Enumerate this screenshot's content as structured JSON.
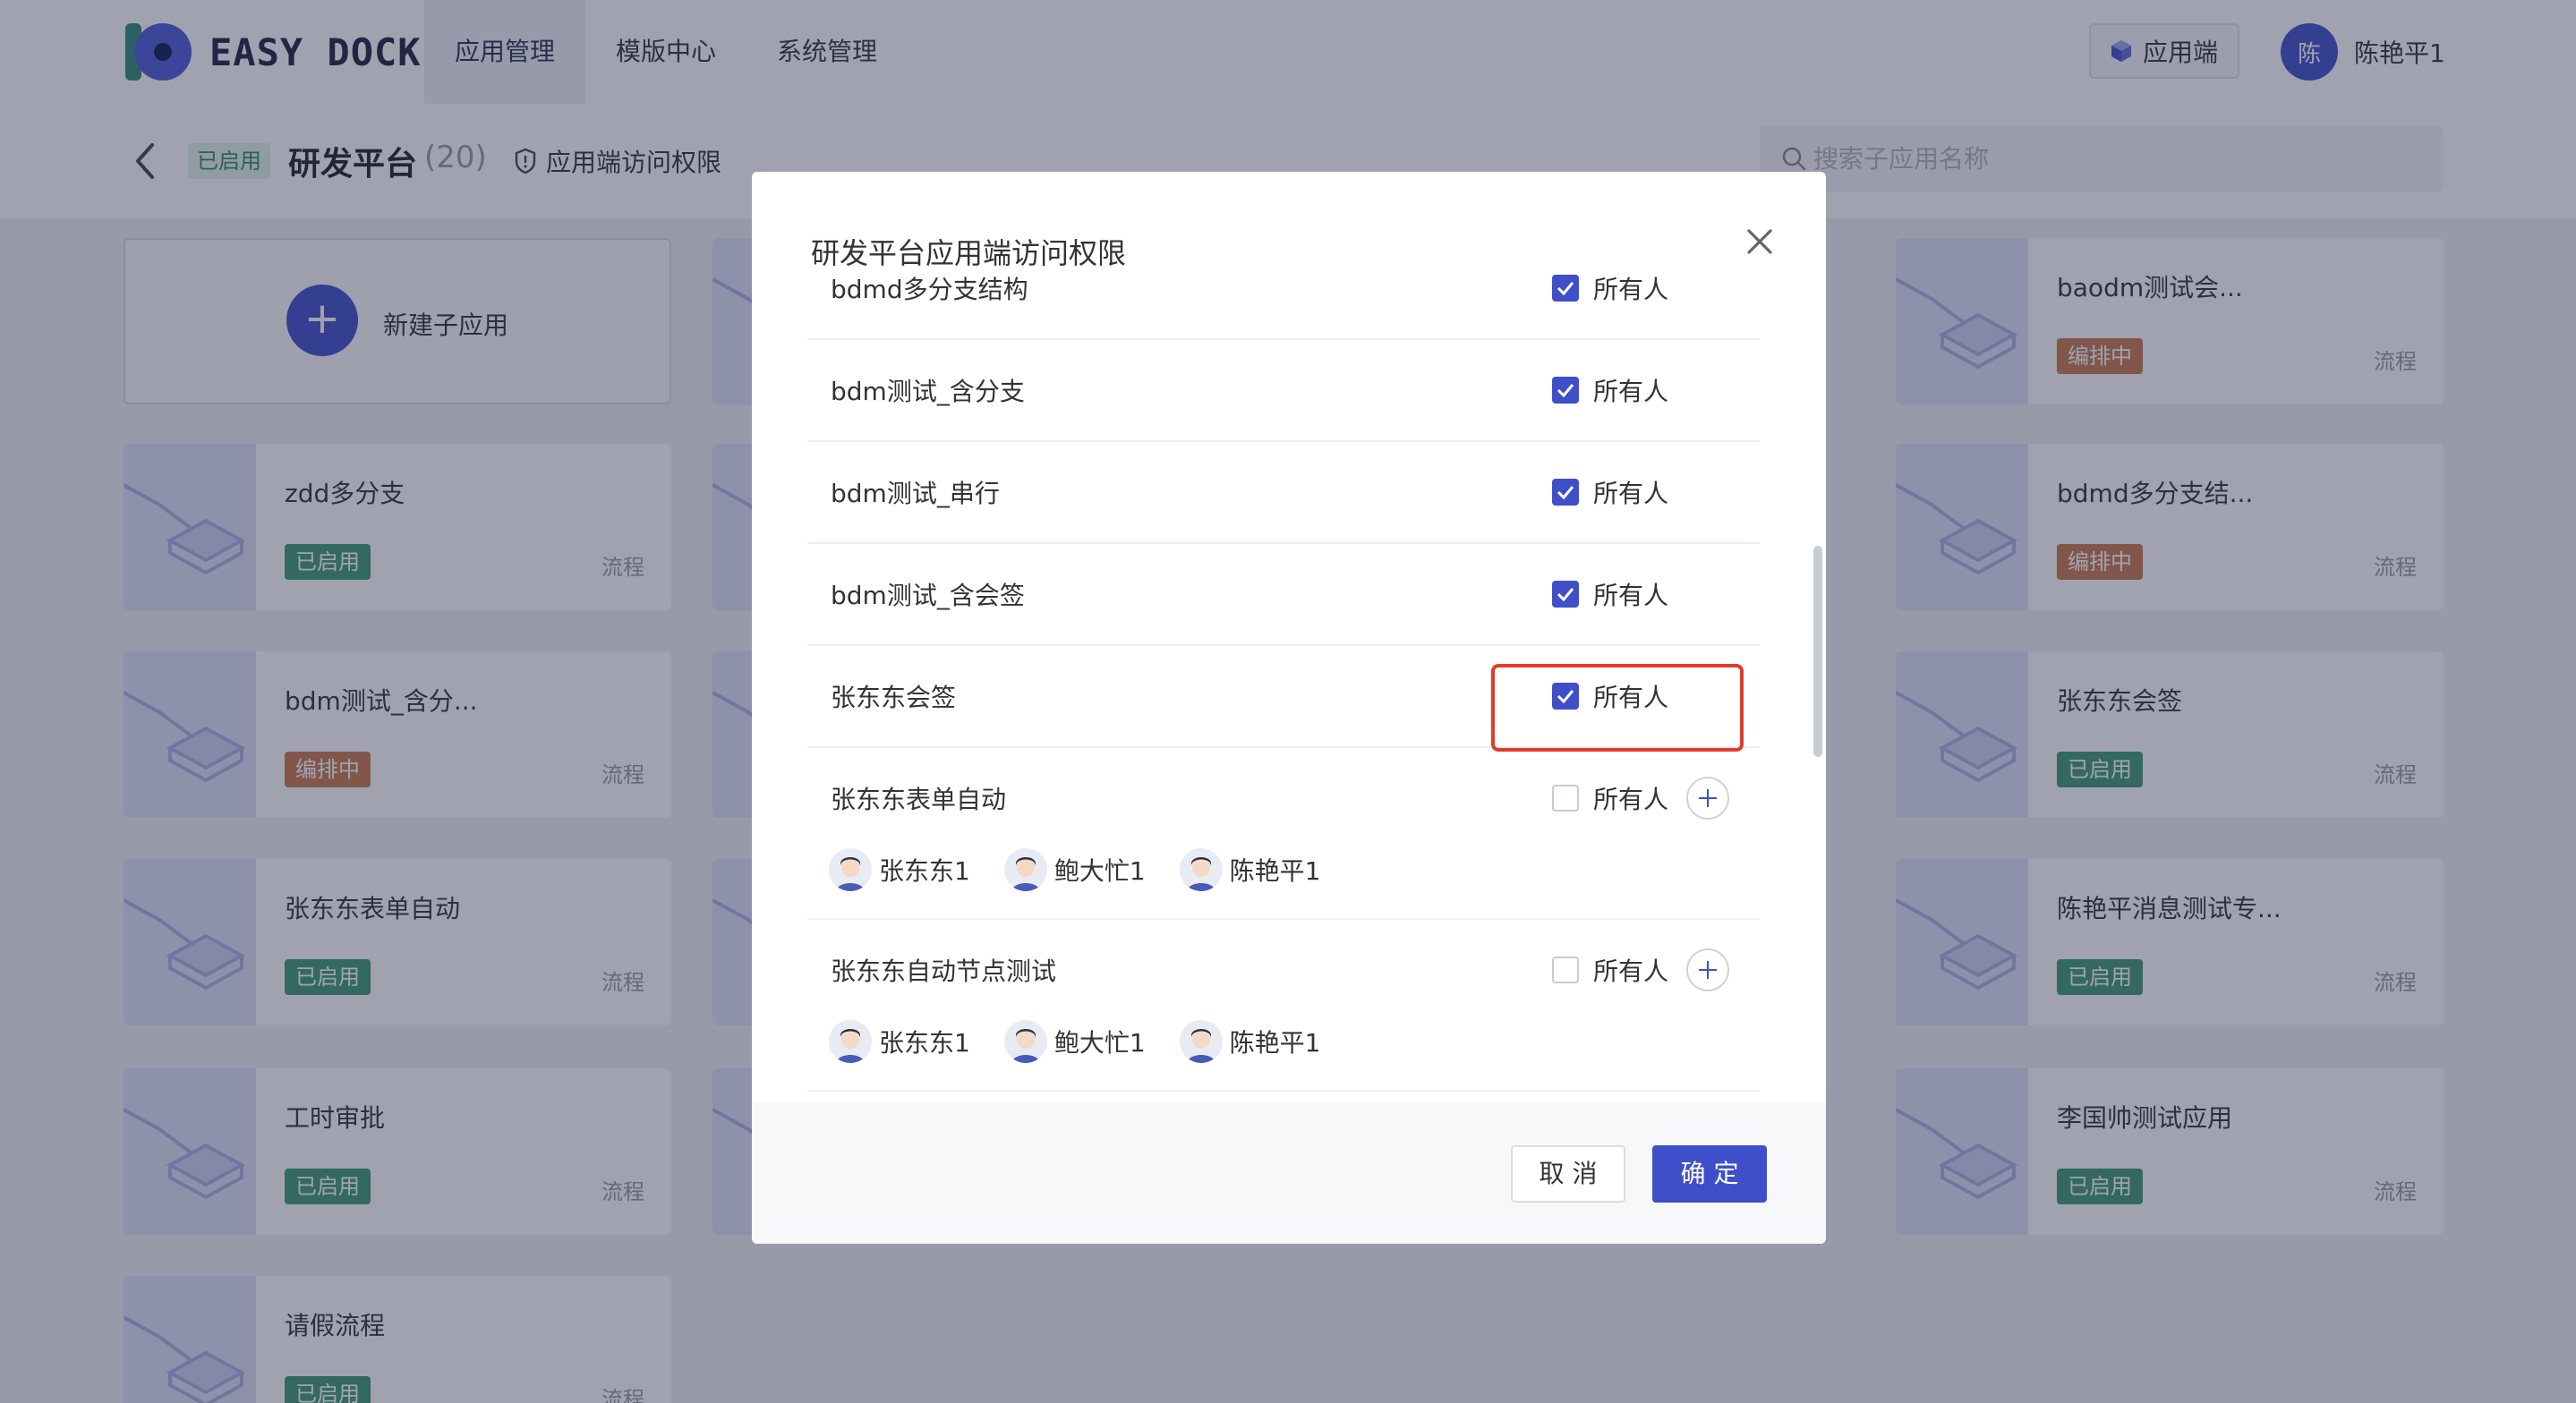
{
  "brand": {
    "name": "EASY DOCK"
  },
  "nav": {
    "items": [
      "应用管理",
      "模版中心",
      "系统管理"
    ]
  },
  "header": {
    "app_end_label": "应用端",
    "user_initial": "陈",
    "user_name": "陈艳平1"
  },
  "subheader": {
    "status": "已启用",
    "title": "研发平台",
    "count": "(20)",
    "perm_link": "应用端访问权限",
    "search_placeholder": "搜索子应用名称"
  },
  "cards": {
    "new_label": "新建子应用",
    "left": [
      {
        "name": "zdd多分支",
        "status": "已启用",
        "type": "流程"
      },
      {
        "name": "bdm测试_含分...",
        "status": "编排中",
        "type": "流程"
      },
      {
        "name": "张东东表单自动",
        "status": "已启用",
        "type": "流程"
      },
      {
        "name": "工时审批",
        "status": "已启用",
        "type": "流程"
      },
      {
        "name": "请假流程",
        "status": "已启用",
        "type": "流程"
      }
    ],
    "right": [
      {
        "name": "baodm测试会...",
        "status": "编排中",
        "type": "流程"
      },
      {
        "name": "bdmd多分支结...",
        "status": "编排中",
        "type": "流程"
      },
      {
        "name": "张东东会签",
        "status": "已启用",
        "type": "流程"
      },
      {
        "name": "陈艳平消息测试专...",
        "status": "已启用",
        "type": "流程"
      },
      {
        "name": "李国帅测试应用",
        "status": "已启用",
        "type": "流程"
      }
    ]
  },
  "modal": {
    "title": "研发平台应用端访问权限",
    "everyone_label": "所有人",
    "rows": [
      {
        "name": "bdmd多分支结构",
        "checked": true
      },
      {
        "name": "bdm测试_含分支",
        "checked": true
      },
      {
        "name": "bdm测试_串行",
        "checked": true
      },
      {
        "name": "bdm测试_含会签",
        "checked": true
      },
      {
        "name": "张东东会签",
        "checked": true
      },
      {
        "name": "张东东表单自动",
        "checked": false,
        "members": [
          "张东东1",
          "鲍大忙1",
          "陈艳平1"
        ]
      },
      {
        "name": "张东东自动节点测试",
        "checked": false,
        "members": [
          "张东东1",
          "鲍大忙1",
          "陈艳平1"
        ]
      }
    ],
    "cancel_label": "取 消",
    "ok_label": "确 定"
  },
  "colors": {
    "primary": "#3e4fc9",
    "enabled": "#3c9a72",
    "editing": "#c77a4e",
    "highlight": "#e23b2e"
  }
}
